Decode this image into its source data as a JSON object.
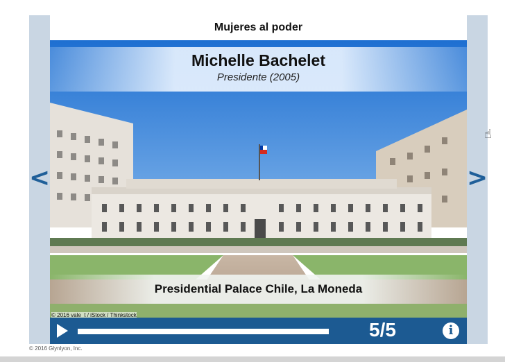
{
  "slide": {
    "header_title": "Mujeres al poder",
    "person_name": "Michelle Bachelet",
    "person_role": "Presidente (2005)",
    "caption": "Presidential Palace Chile, La Moneda",
    "photo_credit": "© 2016 vale_t / iStock / Thinkstock"
  },
  "navigation": {
    "prev_label": "<",
    "next_label": ">"
  },
  "controls": {
    "counter": "5/5",
    "play_icon": "play-icon",
    "info_icon": "info-icon",
    "info_label": "i"
  },
  "footer": {
    "copyright": "© 2016 Glynlyon, Inc."
  },
  "colors": {
    "accent": "#1c5a92",
    "frame": "#c9d6e3",
    "arrow": "#1f5f99"
  }
}
